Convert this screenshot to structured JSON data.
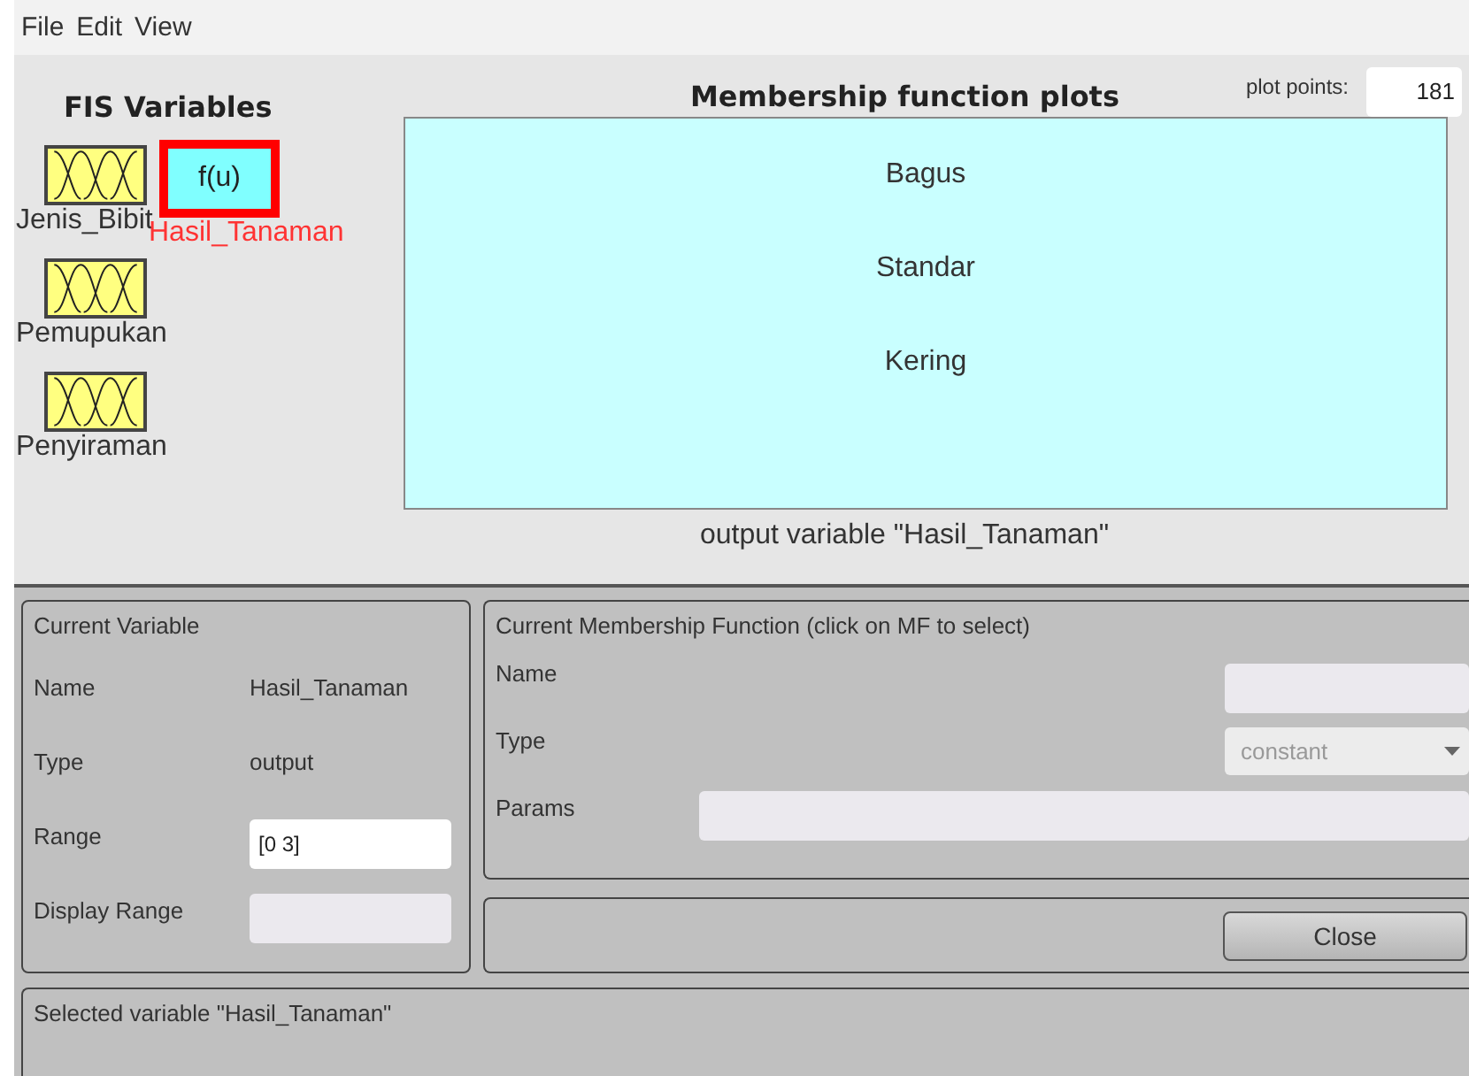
{
  "menu": [
    "File",
    "Edit",
    "View"
  ],
  "fis_variables": {
    "title": "FIS Variables",
    "items": [
      {
        "kind": "input",
        "label": "Jenis_Bibit",
        "selected": false
      },
      {
        "kind": "output",
        "label": "Hasil_Tanaman",
        "icon_text": "f(u)",
        "selected": true
      },
      {
        "kind": "input",
        "label": "Pemupukan",
        "selected": false
      },
      {
        "kind": "input",
        "label": "Penyiraman",
        "selected": false
      }
    ]
  },
  "plot": {
    "title": "Membership function plots",
    "plot_points_label": "plot points:",
    "plot_points": "181",
    "mf_labels": [
      "Bagus",
      "Standar",
      "Kering"
    ],
    "caption": "output variable \"Hasil_Tanaman\""
  },
  "current_variable": {
    "title": "Current Variable",
    "rows": [
      {
        "kind": "text",
        "label": "Name",
        "value": "Hasil_Tanaman"
      },
      {
        "kind": "text",
        "label": "Type",
        "value": "output"
      },
      {
        "kind": "field",
        "label": "Range",
        "value": "[0 3]",
        "disabled": false
      },
      {
        "kind": "field",
        "label": "Display Range",
        "disabled": true
      }
    ]
  },
  "current_mf": {
    "title": "Current Membership Function (click on MF to select)",
    "name_label": "Name",
    "type_label": "Type",
    "type_value": "constant",
    "params_label": "Params"
  },
  "close_button": "Close",
  "status": "Selected variable \"Hasil_Tanaman\""
}
